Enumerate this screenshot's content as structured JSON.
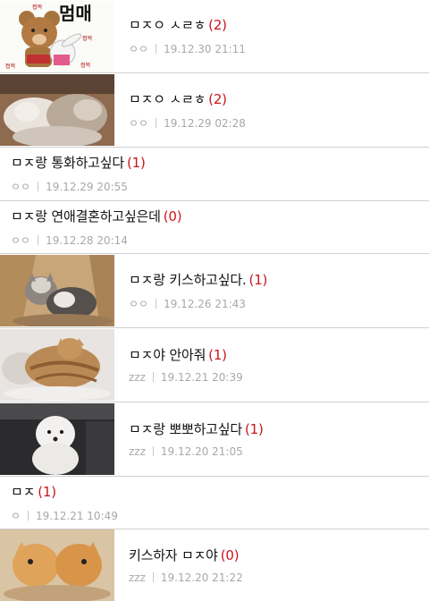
{
  "posts": [
    {
      "title": "ㅁㅈㅇ ㅅㄹㅎ",
      "count": "(2)",
      "author": "ㅇㅇ",
      "date": "19.12.30 21:11",
      "thumb_icon": "bear-rabbit-sticker-icon",
      "sticker": {
        "big": "멈매",
        "small": "쩝쩍"
      }
    },
    {
      "title": "ㅁㅈㅇ ㅅㄹㅎ",
      "count": "(2)",
      "author": "ㅇㅇ",
      "date": "19.12.29 02:28",
      "thumb_icon": "sleeping-kittens-photo-icon"
    },
    {
      "title": "ㅁㅈ랑 통화하고싶다",
      "count": "(1)",
      "author": "ㅇㅇ",
      "date": "19.12.29 20:55"
    },
    {
      "title": "ㅁㅈ랑 연애결혼하고싶은데",
      "count": "(0)",
      "author": "ㅇㅇ",
      "date": "19.12.28 20:14"
    },
    {
      "title": "ㅁㅈ랑 키스하고싶다.",
      "count": "(1)",
      "author": "ㅇㅇ",
      "date": "19.12.26 21:43",
      "thumb_icon": "cats-in-box-photo-icon"
    },
    {
      "title": "ㅁㅈ야 안아줘",
      "count": "(1)",
      "author": "zzz",
      "date": "19.12.21 20:39",
      "thumb_icon": "hugging-cats-photo-icon"
    },
    {
      "title": "ㅁㅈ랑 뽀뽀하고싶다",
      "count": "(1)",
      "author": "zzz",
      "date": "19.12.20 21:05",
      "thumb_icon": "white-puppy-photo-icon"
    },
    {
      "title": "ㅁㅈ",
      "count": "(1)",
      "author": "ㅇ",
      "date": "19.12.21 10:49"
    },
    {
      "title": "키스하자 ㅁㅈ야",
      "count": "(0)",
      "author": "zzz",
      "date": "19.12.20 21:22",
      "thumb_icon": "kissing-kittens-photo-icon"
    }
  ],
  "colors": {
    "comment_count": "#c8161d",
    "meta": "#a8a8a8",
    "divider": "#cfcfcf"
  }
}
